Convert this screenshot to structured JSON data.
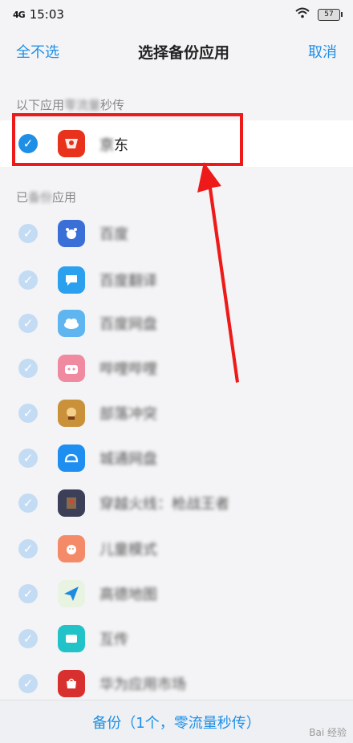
{
  "status": {
    "network": "4G",
    "time": "15:03",
    "battery": "57"
  },
  "header": {
    "select_all": "全不选",
    "title": "选择备份应用",
    "cancel": "取消"
  },
  "fast_section": {
    "label_visible": "以下应用",
    "label_blurred": "零流量",
    "label_end": "秒传",
    "app": {
      "name_blur": "京",
      "name_clear": "东",
      "icon": "jd-icon",
      "icon_color": "#e8321c"
    }
  },
  "backed_section": {
    "label_start": "已",
    "label_blurred": "备份",
    "label_end": "应用"
  },
  "apps": [
    {
      "name": "百度",
      "icon": "baidu-icon",
      "color": "#3a6fd8"
    },
    {
      "name": "百度翻译",
      "icon": "baidu-translate-icon",
      "color": "#2aa0ee"
    },
    {
      "name": "百度网盘",
      "icon": "baidu-netdisk-icon",
      "color": "#5fb5f0"
    },
    {
      "name": "哔哩哔哩",
      "icon": "bilibili-icon",
      "color": "#f08aa0"
    },
    {
      "name": "部落冲突",
      "icon": "clash-icon",
      "color": "#c9923a"
    },
    {
      "name": "城通网盘",
      "icon": "ctfile-icon",
      "color": "#1e8ef0"
    },
    {
      "name": "穿越火线：枪战王者",
      "icon": "cf-icon",
      "color": "#3b3f58"
    },
    {
      "name": "儿童模式",
      "icon": "kids-mode-icon",
      "color": "#f48a68"
    },
    {
      "name": "高德地图",
      "icon": "amap-icon",
      "color": "#1d8ce0"
    },
    {
      "name": "互传",
      "icon": "transfer-icon",
      "color": "#22c3c8"
    },
    {
      "name": "华为应用市场",
      "icon": "huawei-appgallery-icon",
      "color": "#d8302e"
    }
  ],
  "bottom": {
    "backup_label": "备份（1个，零流量秒传）"
  },
  "watermark": "Bai 经验",
  "colors": {
    "accent": "#1f8fe5",
    "highlight": "#ee1a1a"
  }
}
